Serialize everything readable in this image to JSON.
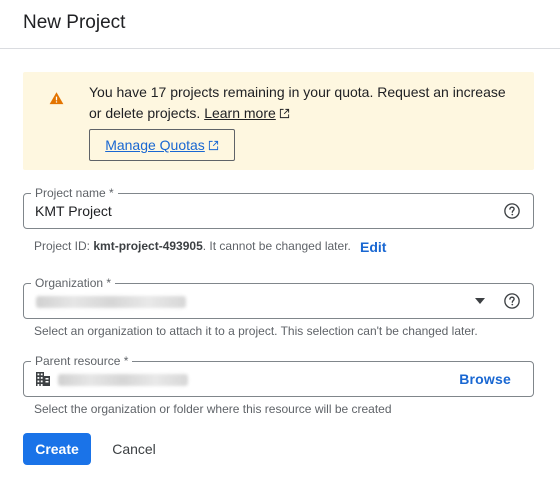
{
  "dialog": {
    "title": "New Project"
  },
  "quota_banner": {
    "message": "You have 17 projects remaining in your quota. Request an increase or delete projects.",
    "learn_more_label": "Learn more",
    "manage_quotas_label": "Manage Quotas",
    "warning_icon": "warning-triangle-icon",
    "external_icon": "open-in-new-icon",
    "background_color": "#fef7e0",
    "icon_color": "#e37400"
  },
  "project_name": {
    "label": "Project name *",
    "value": "KMT Project",
    "help_icon": "help-circle-icon"
  },
  "project_id": {
    "prefix": "Project ID: ",
    "value": "kmt-project-493905",
    "suffix": ". It cannot be changed later.",
    "edit_label": "Edit"
  },
  "organization": {
    "label": "Organization *",
    "help_text": "Select an organization to attach it to a project. This selection can't be changed later.",
    "dropdown_icon": "arrow-drop-down-icon",
    "help_icon": "help-circle-icon"
  },
  "parent_resource": {
    "label": "Parent resource *",
    "browse_label": "Browse",
    "help_text": "Select the organization or folder where this resource will be created",
    "resource_icon": "building-icon"
  },
  "actions": {
    "create_label": "Create",
    "cancel_label": "Cancel"
  },
  "colors": {
    "primary": "#1a73e8",
    "link": "#1967d2",
    "border": "#80868b"
  }
}
